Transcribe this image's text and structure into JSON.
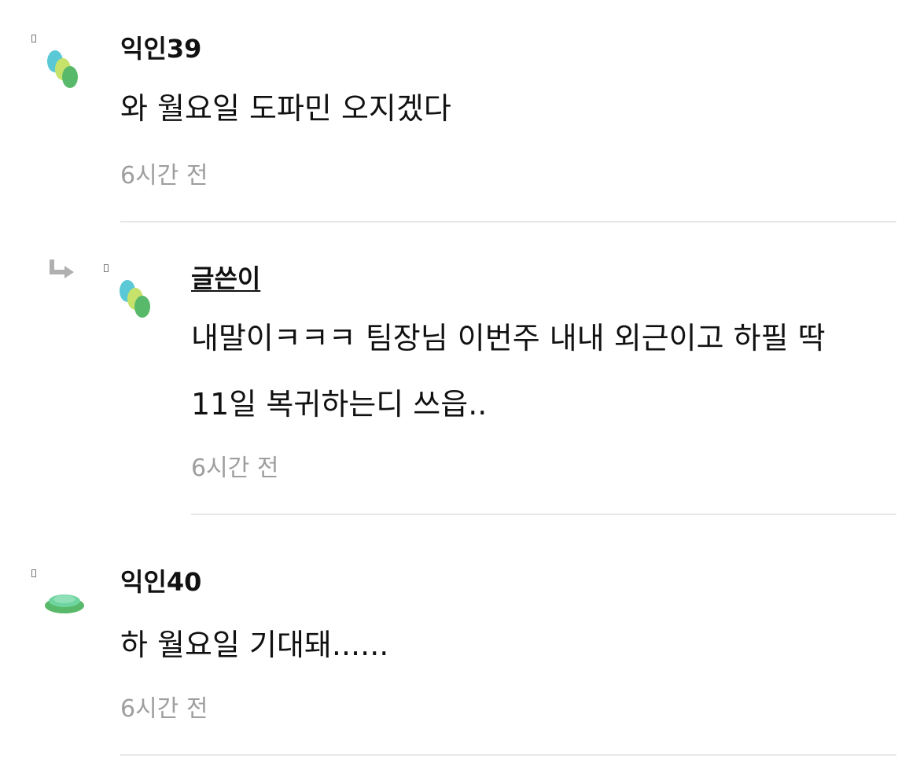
{
  "comments": [
    {
      "author": "익인39",
      "text": "와 월요일 도파민 오지겠다",
      "time": "6시간 전",
      "avatar_icon": "three-dot-avatar-icon"
    },
    {
      "author": "글쓴이",
      "is_reply": true,
      "lines": [
        "내말이ㅋㅋㅋ 팀장님 이번주 내내 외근이고 하필 딱",
        "11일 복귀하는디 쓰읍.."
      ],
      "time": "6시간 전",
      "avatar_icon": "three-dot-avatar-icon"
    },
    {
      "author": "익인40",
      "text": "하 월요일 기대돼......",
      "time": "6시간 전",
      "avatar_icon": "stacked-discs-avatar-icon"
    }
  ],
  "colors": {
    "teal": "#5bc8d6",
    "lime": "#c6e26b",
    "green": "#58b96a",
    "mint": "#6ed4a0",
    "time_gray": "#9e9e9e",
    "divider": "#e8e8e8"
  }
}
